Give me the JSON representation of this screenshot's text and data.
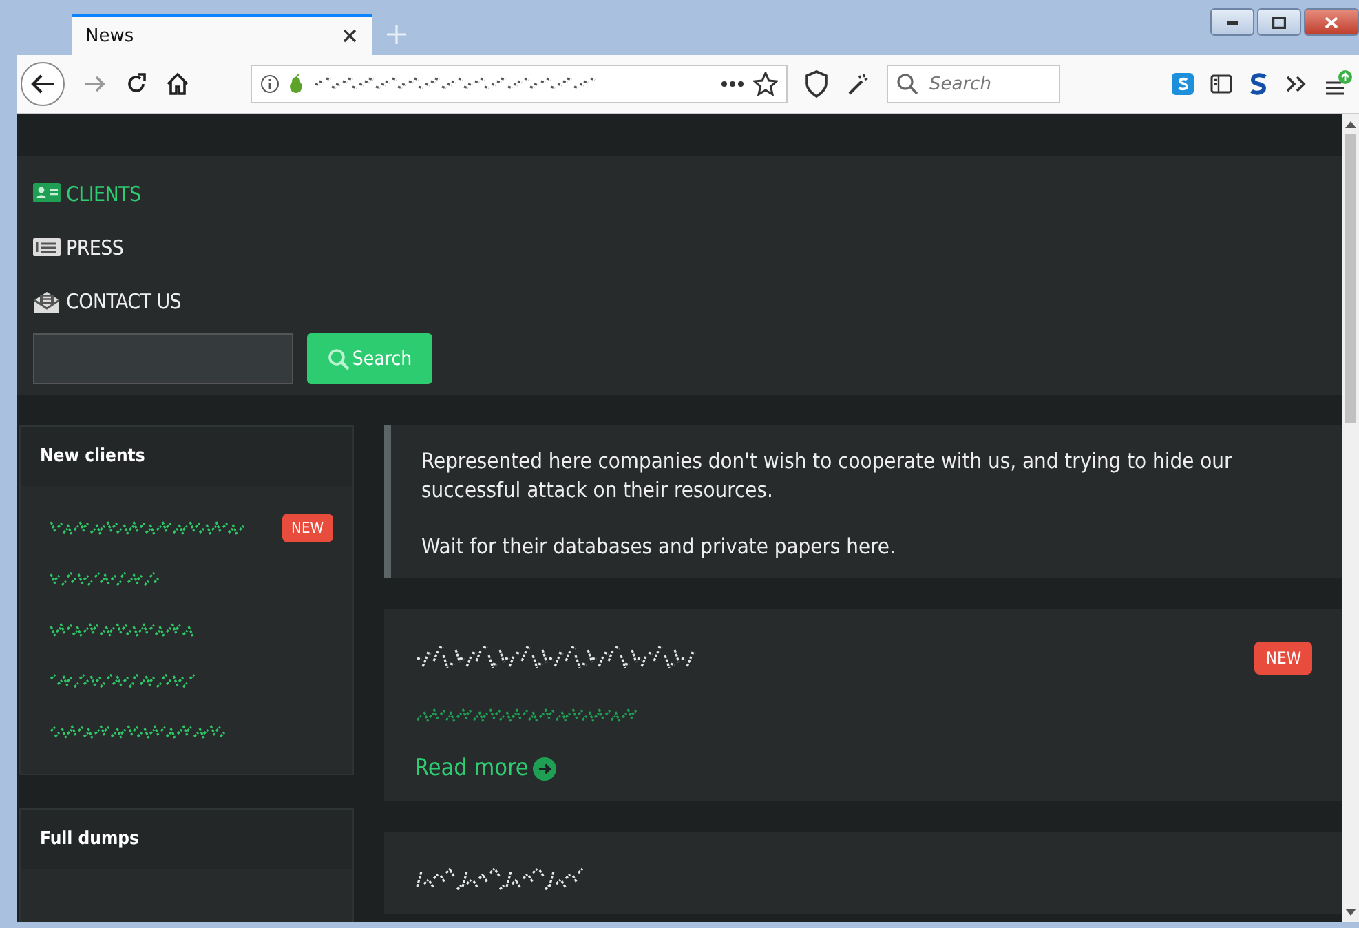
{
  "window": {
    "tabs": [
      {
        "label": "News",
        "selected": true
      }
    ]
  },
  "toolbar": {
    "search_placeholder": "Search"
  },
  "nav": {
    "items": [
      {
        "label": "CLIENTS",
        "selected": true
      },
      {
        "label": "PRESS",
        "selected": false
      },
      {
        "label": "CONTACT US",
        "selected": false
      }
    ],
    "search_button": "Search"
  },
  "sidebar": [
    {
      "title": "New clients",
      "items": [
        {
          "new": true,
          "badge": "NEW"
        },
        {
          "new": false
        },
        {
          "new": false
        },
        {
          "new": false
        },
        {
          "new": false
        }
      ]
    },
    {
      "title": "Full dumps"
    }
  ],
  "notice": {
    "paragraphs": [
      "Represented here companies don't wish to cooperate with us, and trying to hide our successful attack on their resources.",
      "Wait for their databases and private papers here."
    ]
  },
  "posts": [
    {
      "new": true,
      "badge": "NEW",
      "link": "Read more"
    },
    {
      "new": false
    }
  ]
}
